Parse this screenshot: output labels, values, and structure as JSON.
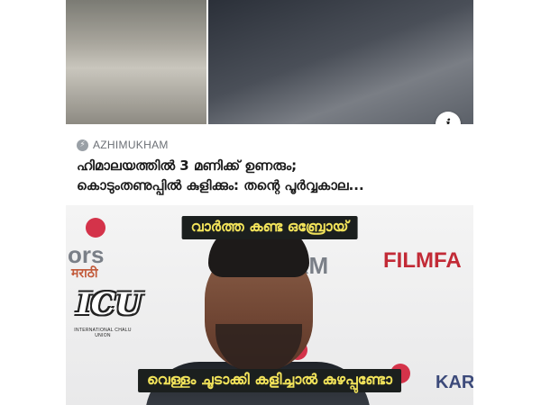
{
  "news_card": {
    "source": "AZHIMUKHAM",
    "headline_line1": "ഹിമാലയത്തിൽ 3 മണിക്ക് ഉണരും;",
    "headline_line2": "കൊടുംതണുപ്പിൽ കുളിക്കും: തന്റെ പൂർവ്വകാല...",
    "info_icon": "i"
  },
  "meme": {
    "caption_top": "വാർത്ത കണ്ട ഒബ്രോയ്",
    "caption_bottom": "വെള്ളം ചൂടാക്കി കളിച്ചാൽ കുഴപ്പുണ്ടോ",
    "background_text": {
      "ors": "ors",
      "marathi": "मराठी",
      "rrm": "RRM",
      "filmfare": "FILMFA",
      "kar": "KAR"
    },
    "logo": {
      "mark": "ICU",
      "subtitle": "INTERNATIONAL CHALU UNION"
    }
  },
  "colors": {
    "caption_bg": "#1b1f1e",
    "caption_text": "#f1e25a",
    "filmfare_red": "#c22a36"
  }
}
